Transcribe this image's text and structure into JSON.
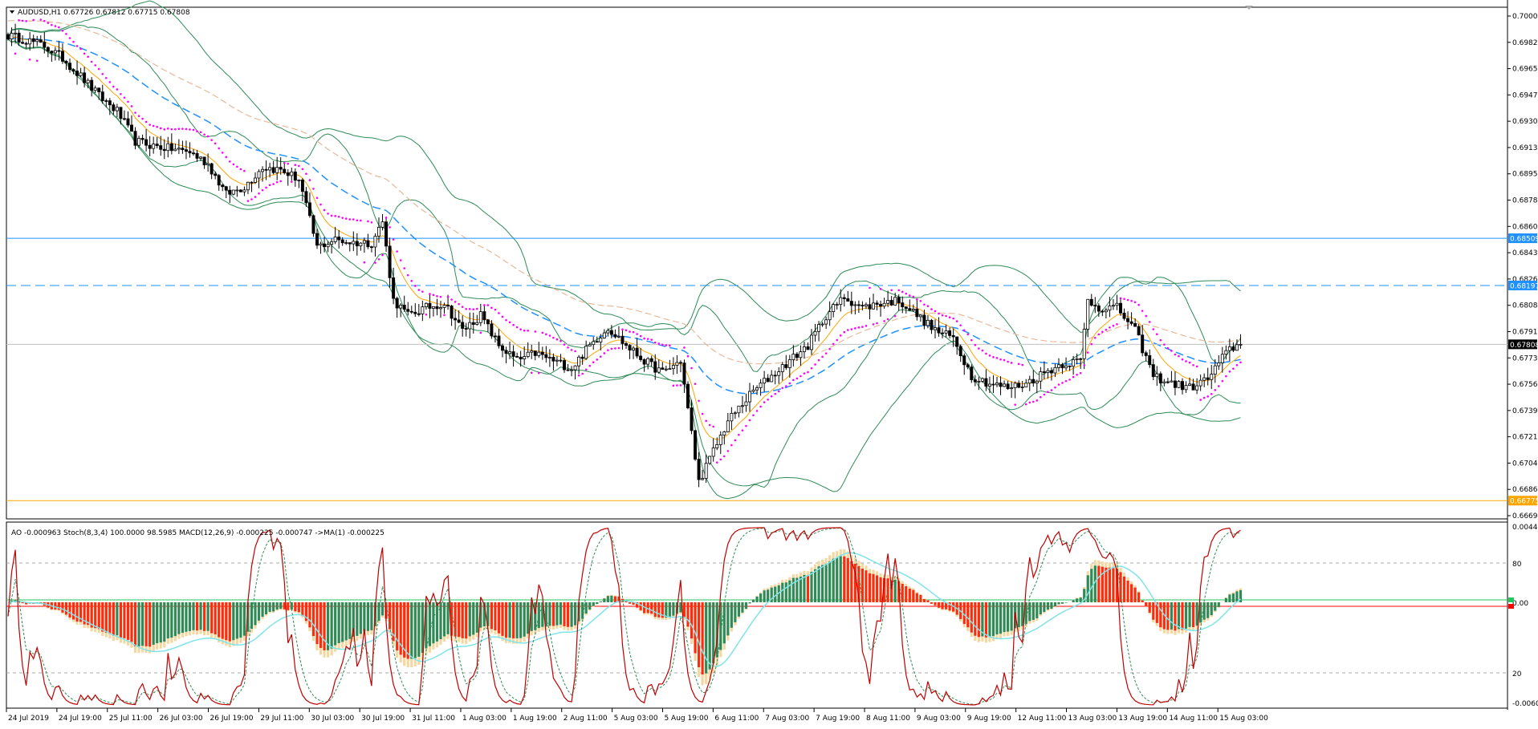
{
  "window": {
    "symbol_info": "AUDUSD,H1  0.67726 0.67812 0.67715 0.67808"
  },
  "indicator_info": "AO -0.000963  Stoch(8,3,4) 100.0000 98.5985  MACD(12,26,9) -0.000225 -0.000747  ->MA(1) -0.000225",
  "chart_data": [
    {
      "type": "candlestick",
      "name": "AUDUSD,H1",
      "x_labels": [
        "24 Jul 2019",
        "24 Jul 19:00",
        "25 Jul 11:00",
        "26 Jul 03:00",
        "26 Jul 19:00",
        "29 Jul 11:00",
        "30 Jul 03:00",
        "30 Jul 19:00",
        "31 Jul 11:00",
        "1 Aug 03:00",
        "1 Aug 19:00",
        "2 Aug 11:00",
        "5 Aug 03:00",
        "5 Aug 19:00",
        "6 Aug 11:00",
        "7 Aug 03:00",
        "7 Aug 19:00",
        "8 Aug 11:00",
        "9 Aug 03:00",
        "9 Aug 19:00",
        "12 Aug 11:00",
        "13 Aug 03:00",
        "13 Aug 19:00",
        "14 Aug 11:00",
        "15 Aug 03:00"
      ],
      "y_ticks": [
        "0.70000",
        "0.69825",
        "0.69650",
        "0.69475",
        "0.69300",
        "0.69130",
        "0.68955",
        "0.68780",
        "0.68605",
        "0.68435",
        "0.68260",
        "0.68085",
        "0.67910",
        "0.67735",
        "0.67565",
        "0.67390",
        "0.67215",
        "0.67040",
        "0.66865",
        "0.66695"
      ],
      "ylim": [
        0.66665,
        0.7002
      ],
      "close_path": [
        [
          0,
          0.6985
        ],
        [
          5,
          0.6982
        ],
        [
          10,
          0.6978
        ],
        [
          15,
          0.697
        ],
        [
          20,
          0.6958
        ],
        [
          25,
          0.6945
        ],
        [
          30,
          0.6935
        ],
        [
          35,
          0.6915
        ],
        [
          40,
          0.6912
        ],
        [
          45,
          0.691
        ],
        [
          50,
          0.6908
        ],
        [
          55,
          0.69
        ],
        [
          60,
          0.688
        ],
        [
          65,
          0.6885
        ],
        [
          70,
          0.6898
        ],
        [
          75,
          0.6896
        ],
        [
          80,
          0.689
        ],
        [
          85,
          0.6845
        ],
        [
          90,
          0.685
        ],
        [
          95,
          0.6848
        ],
        [
          100,
          0.6848
        ],
        [
          103,
          0.6862
        ],
        [
          106,
          0.681
        ],
        [
          110,
          0.68
        ],
        [
          115,
          0.6805
        ],
        [
          120,
          0.6808
        ],
        [
          125,
          0.679
        ],
        [
          130,
          0.68
        ],
        [
          135,
          0.678
        ],
        [
          140,
          0.677
        ],
        [
          145,
          0.6775
        ],
        [
          150,
          0.677
        ],
        [
          155,
          0.6765
        ],
        [
          160,
          0.678
        ],
        [
          165,
          0.6792
        ],
        [
          170,
          0.678
        ],
        [
          175,
          0.677
        ],
        [
          180,
          0.6762
        ],
        [
          185,
          0.677
        ],
        [
          190,
          0.669
        ],
        [
          193,
          0.6705
        ],
        [
          198,
          0.673
        ],
        [
          205,
          0.675
        ],
        [
          210,
          0.676
        ],
        [
          215,
          0.677
        ],
        [
          220,
          0.678
        ],
        [
          225,
          0.68
        ],
        [
          230,
          0.6812
        ],
        [
          235,
          0.6805
        ],
        [
          240,
          0.6808
        ],
        [
          245,
          0.681
        ],
        [
          250,
          0.68
        ],
        [
          255,
          0.679
        ],
        [
          260,
          0.6785
        ],
        [
          265,
          0.676
        ],
        [
          270,
          0.6755
        ],
        [
          275,
          0.6752
        ],
        [
          280,
          0.6755
        ],
        [
          285,
          0.6762
        ],
        [
          290,
          0.6768
        ],
        [
          295,
          0.677
        ],
        [
          297,
          0.681
        ],
        [
          300,
          0.6805
        ],
        [
          305,
          0.6805
        ],
        [
          310,
          0.679
        ],
        [
          315,
          0.676
        ],
        [
          320,
          0.6755
        ],
        [
          325,
          0.6752
        ],
        [
          330,
          0.6758
        ],
        [
          335,
          0.6775
        ],
        [
          338,
          0.67808
        ]
      ],
      "horizontal_lines": [
        {
          "price": 0.68509,
          "color": "#1e90ff",
          "style": "solid",
          "tag": "0.68509"
        },
        {
          "price": 0.68197,
          "color": "#1e90ff",
          "style": "dashed",
          "tag": "0.68197"
        },
        {
          "price": 0.67808,
          "color": "#c0c0c0",
          "style": "solid",
          "tag": "0.67808"
        },
        {
          "price": 0.66775,
          "color": "#ffa500",
          "style": "solid",
          "tag": "0.66775"
        }
      ],
      "colors": {
        "up": "#000000",
        "down": "#000000",
        "ema": "#ffa500",
        "bands": "#2e8b57",
        "ma_blue": "#1e90ff",
        "ma_tan": "#e8b99a",
        "psar": "#ff00ff"
      }
    },
    {
      "type": "oscillator",
      "name": "AO / Stoch / MACD",
      "y_ticks": [
        "0.004422",
        "80",
        "0.00",
        "20",
        "-0.006093"
      ],
      "ylim": [
        -0.006093,
        0.004422
      ],
      "stoch_levels": [
        80,
        20
      ],
      "colors": {
        "ao_up": "#2e8b57",
        "ao_down": "#ff2b0a",
        "macd_hist": "#f5d7a0",
        "macd_signal": "#7fe4ea",
        "stoch_main": "#c00000",
        "stoch_signal": "#2e8b57",
        "zero_line": "#22c55e",
        "tag_red": "#ff0000"
      }
    }
  ]
}
